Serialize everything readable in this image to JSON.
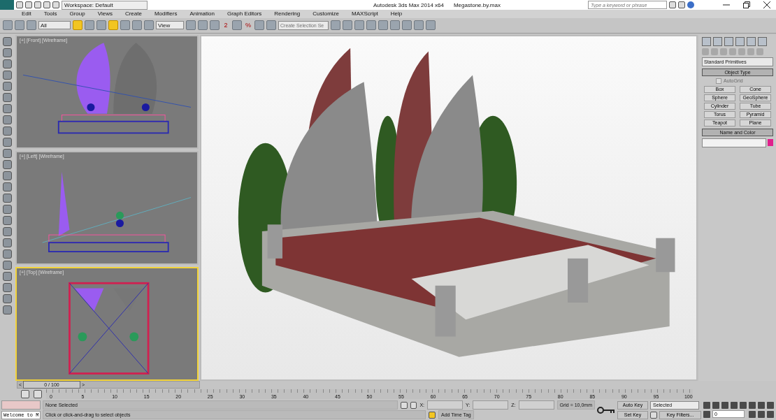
{
  "title_bar": {
    "workspace": "Workspace: Default",
    "app_title": "Autodesk 3ds Max  2014 x64",
    "file_name": "Megastone.by.max",
    "search": {
      "placeholder": "Type a keyword or phrase"
    }
  },
  "menu": [
    "Edit",
    "Tools",
    "Group",
    "Views",
    "Create",
    "Modifiers",
    "Animation",
    "Graph Editors",
    "Rendering",
    "Customize",
    "MAXScript",
    "Help"
  ],
  "toolbar": {
    "selection_filter": "All",
    "reference_coordinate": "View",
    "named_selection": {
      "placeholder": "Create Selection Se"
    },
    "snap_label": "2",
    "percent_label": "%"
  },
  "viewports": [
    {
      "label": "[+] [Front] [Wireframe]",
      "kind": "front",
      "selected": false
    },
    {
      "label": "[+] [Left] [Wireframe]",
      "kind": "left",
      "selected": false
    },
    {
      "label": "[+] [Top] [Wireframe]",
      "kind": "top",
      "selected": true
    }
  ],
  "command_panel": {
    "dropdown": "Standard Primitives",
    "object_type": {
      "title": "Object Type",
      "autogrid": {
        "label": "AutoGrid",
        "checked": false,
        "disabled": true
      },
      "buttons": [
        "Box",
        "Cone",
        "Sphere",
        "GeoSphere",
        "Cylinder",
        "Tube",
        "Torus",
        "Pyramid",
        "Teapot",
        "Plane"
      ]
    },
    "name_and_color": {
      "title": "Name and Color",
      "color": "#e0208c"
    }
  },
  "timeline": {
    "frame_display": "0 / 100",
    "level": 0,
    "prev": "<",
    "next": ">",
    "ticks": [
      "0",
      "5",
      "10",
      "15",
      "20",
      "25",
      "30",
      "35",
      "40",
      "45",
      "50",
      "55",
      "60",
      "65",
      "70",
      "75",
      "80",
      "85",
      "90",
      "95",
      "100"
    ]
  },
  "status_bar": {
    "selection": "None Selected",
    "prompt": "Click or click-and-drag to select objects",
    "listener": "Welcome to M",
    "x_label": "X:",
    "y_label": "Y:",
    "z_label": "Z:",
    "grid": "Grid = 10,0mm",
    "add_time_tag": "Add Time Tag",
    "auto_key": "Auto Key",
    "set_key": "Set Key",
    "key_mode": "Selected",
    "key_filters": "Key Filters...",
    "current_frame": "0"
  }
}
